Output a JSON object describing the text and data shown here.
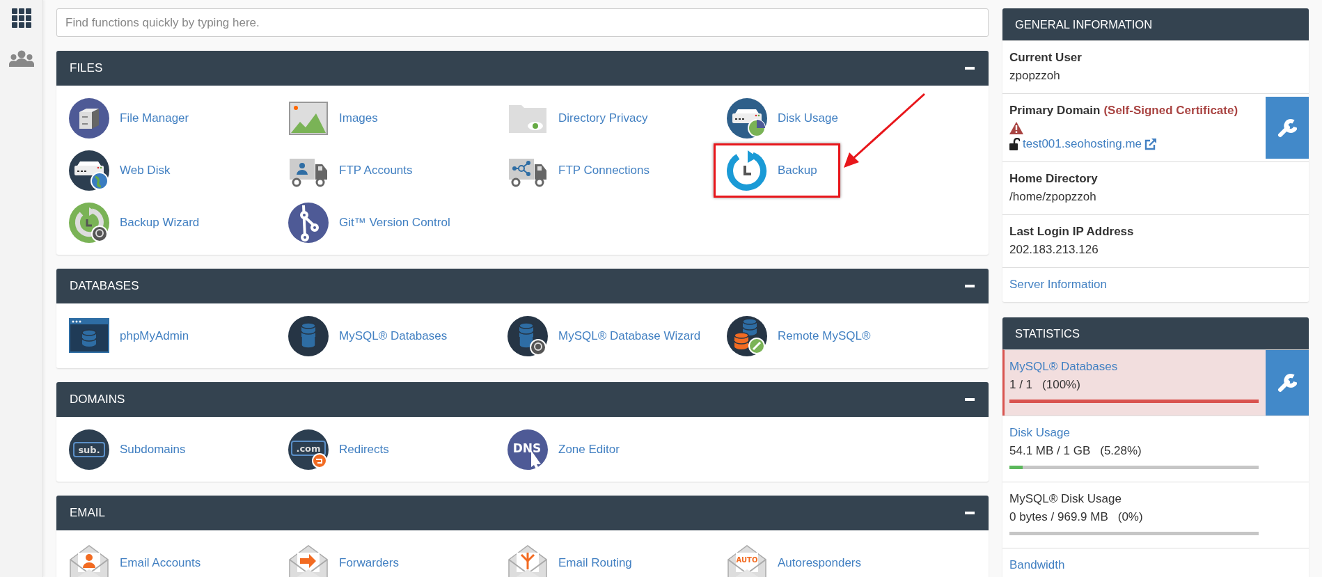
{
  "search": {
    "placeholder": "Find functions quickly by typing here."
  },
  "sections": [
    {
      "title": "FILES",
      "expanded": true,
      "items": [
        {
          "label": "File Manager",
          "highlighted": false
        },
        {
          "label": "Images",
          "highlighted": false
        },
        {
          "label": "Directory Privacy",
          "highlighted": false
        },
        {
          "label": "Disk Usage",
          "highlighted": false
        },
        {
          "label": "Web Disk",
          "highlighted": false
        },
        {
          "label": "FTP Accounts",
          "highlighted": false
        },
        {
          "label": "FTP Connections",
          "highlighted": false
        },
        {
          "label": "Backup",
          "highlighted": true
        },
        {
          "label": "Backup Wizard",
          "highlighted": false
        },
        {
          "label": "Git™ Version Control",
          "highlighted": false
        }
      ]
    },
    {
      "title": "DATABASES",
      "expanded": true,
      "items": [
        {
          "label": "phpMyAdmin",
          "highlighted": false
        },
        {
          "label": "MySQL® Databases",
          "highlighted": false
        },
        {
          "label": "MySQL® Database Wizard",
          "highlighted": false
        },
        {
          "label": "Remote MySQL®",
          "highlighted": false
        }
      ]
    },
    {
      "title": "DOMAINS",
      "expanded": true,
      "items": [
        {
          "label": "Subdomains",
          "highlighted": false,
          "icon_text": "sub."
        },
        {
          "label": "Redirects",
          "highlighted": false,
          "icon_text": ".com"
        },
        {
          "label": "Zone Editor",
          "highlighted": false,
          "icon_text": "DNS"
        }
      ]
    },
    {
      "title": "EMAIL",
      "expanded": true,
      "items": [
        {
          "label": "Email Accounts",
          "highlighted": false
        },
        {
          "label": "Forwarders",
          "highlighted": false
        },
        {
          "label": "Email Routing",
          "highlighted": false
        },
        {
          "label": "Autoresponders",
          "highlighted": false,
          "icon_text": "AUTO"
        }
      ]
    }
  ],
  "general_information": {
    "title": "GENERAL INFORMATION",
    "rows": [
      {
        "kind": "field",
        "label": "Current User",
        "value": "zpopzzoh"
      },
      {
        "kind": "domain",
        "label": "Primary Domain",
        "note": "(Self-Signed Certificate)",
        "domain": "test001.seohosting.me"
      },
      {
        "kind": "field",
        "label": "Home Directory",
        "value": "/home/zpopzzoh"
      },
      {
        "kind": "field",
        "label": "Last Login IP Address",
        "value": "202.183.213.126"
      },
      {
        "kind": "link",
        "label": "Server Information"
      }
    ]
  },
  "statistics": {
    "title": "STATISTICS",
    "rows": [
      {
        "label": "MySQL® Databases",
        "link": true,
        "warning": true,
        "value": "1 / 1",
        "percent": "(100%)",
        "level": 1
      },
      {
        "label": "Disk Usage",
        "link": true,
        "warning": false,
        "value": "54.1 MB / 1 GB",
        "percent": "(5.28%)",
        "level": 0.0528
      },
      {
        "label": "MySQL® Disk Usage",
        "link": false,
        "warning": false,
        "value": "0 bytes / 969.9 MB",
        "percent": "(0%)",
        "level": 0
      },
      {
        "label": "Bandwidth",
        "link": true,
        "warning": false
      }
    ]
  }
}
